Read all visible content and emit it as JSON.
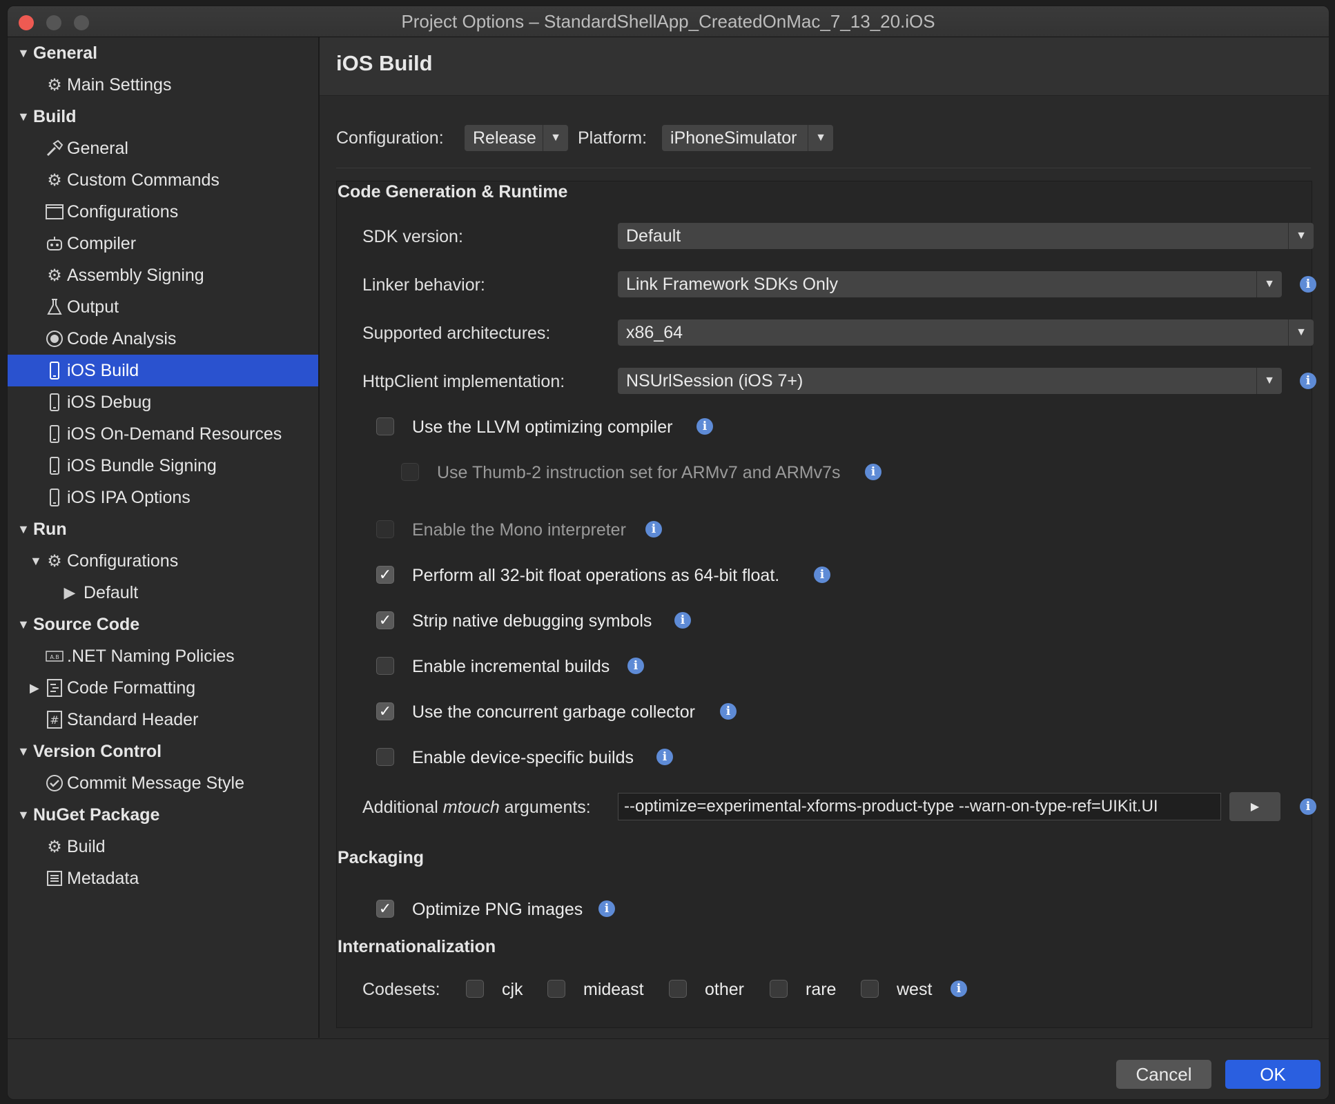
{
  "window": {
    "title": "Project Options – StandardShellApp_CreatedOnMac_7_13_20.iOS"
  },
  "sidebar": {
    "sections": {
      "general": "General",
      "build": "Build",
      "run": "Run",
      "source_code": "Source Code",
      "version_control": "Version Control",
      "nuget": "NuGet Package"
    },
    "items": {
      "main_settings": "Main Settings",
      "build_general": "General",
      "custom_commands": "Custom Commands",
      "configurations": "Configurations",
      "compiler": "Compiler",
      "assembly_signing": "Assembly Signing",
      "output": "Output",
      "code_analysis": "Code Analysis",
      "ios_build": "iOS Build",
      "ios_debug": "iOS Debug",
      "ios_odr": "iOS On-Demand Resources",
      "ios_bundle_signing": "iOS Bundle Signing",
      "ios_ipa": "iOS IPA Options",
      "run_configurations": "Configurations",
      "run_default": "Default",
      "net_naming": ".NET Naming Policies",
      "code_formatting": "Code Formatting",
      "standard_header": "Standard Header",
      "commit_message": "Commit Message Style",
      "nuget_build": "Build",
      "nuget_metadata": "Metadata"
    }
  },
  "main": {
    "title": "iOS Build",
    "configuration_label": "Configuration:",
    "configuration_value": "Release",
    "platform_label": "Platform:",
    "platform_value": "iPhoneSimulator",
    "code_gen": {
      "title": "Code Generation & Runtime",
      "sdk_label": "SDK version:",
      "sdk_value": "Default",
      "linker_label": "Linker behavior:",
      "linker_value": "Link Framework SDKs Only",
      "arch_label": "Supported architectures:",
      "arch_value": "x86_64",
      "http_label": "HttpClient implementation:",
      "http_value": "NSUrlSession (iOS 7+)",
      "llvm": "Use the LLVM optimizing compiler",
      "thumb": "Use Thumb-2 instruction set for ARMv7 and ARMv7s",
      "mono_interp": "Enable the Mono interpreter",
      "float64": "Perform all 32-bit float operations as 64-bit float.",
      "strip": "Strip native debugging symbols",
      "incremental": "Enable incremental builds",
      "concurrent_gc": "Use the concurrent garbage collector",
      "device_specific": "Enable device-specific builds",
      "mtouch_label_pre": "Additional ",
      "mtouch_label_em": "mtouch",
      "mtouch_label_post": " arguments:",
      "mtouch_value": "--optimize=experimental-xforms-product-type --warn-on-type-ref=UIKit.UI"
    },
    "packaging": {
      "title": "Packaging",
      "optimize_png": "Optimize PNG images"
    },
    "i18n": {
      "title": "Internationalization",
      "codesets_label": "Codesets:",
      "cjk": "cjk",
      "mideast": "mideast",
      "other": "other",
      "rare": "rare",
      "west": "west"
    }
  },
  "footer": {
    "cancel": "Cancel",
    "ok": "OK"
  },
  "colors": {
    "selection": "#2a52cf",
    "ok_button": "#2a5fe0",
    "info_icon": "#5e8bd6",
    "close_button": "#ee5a52"
  }
}
